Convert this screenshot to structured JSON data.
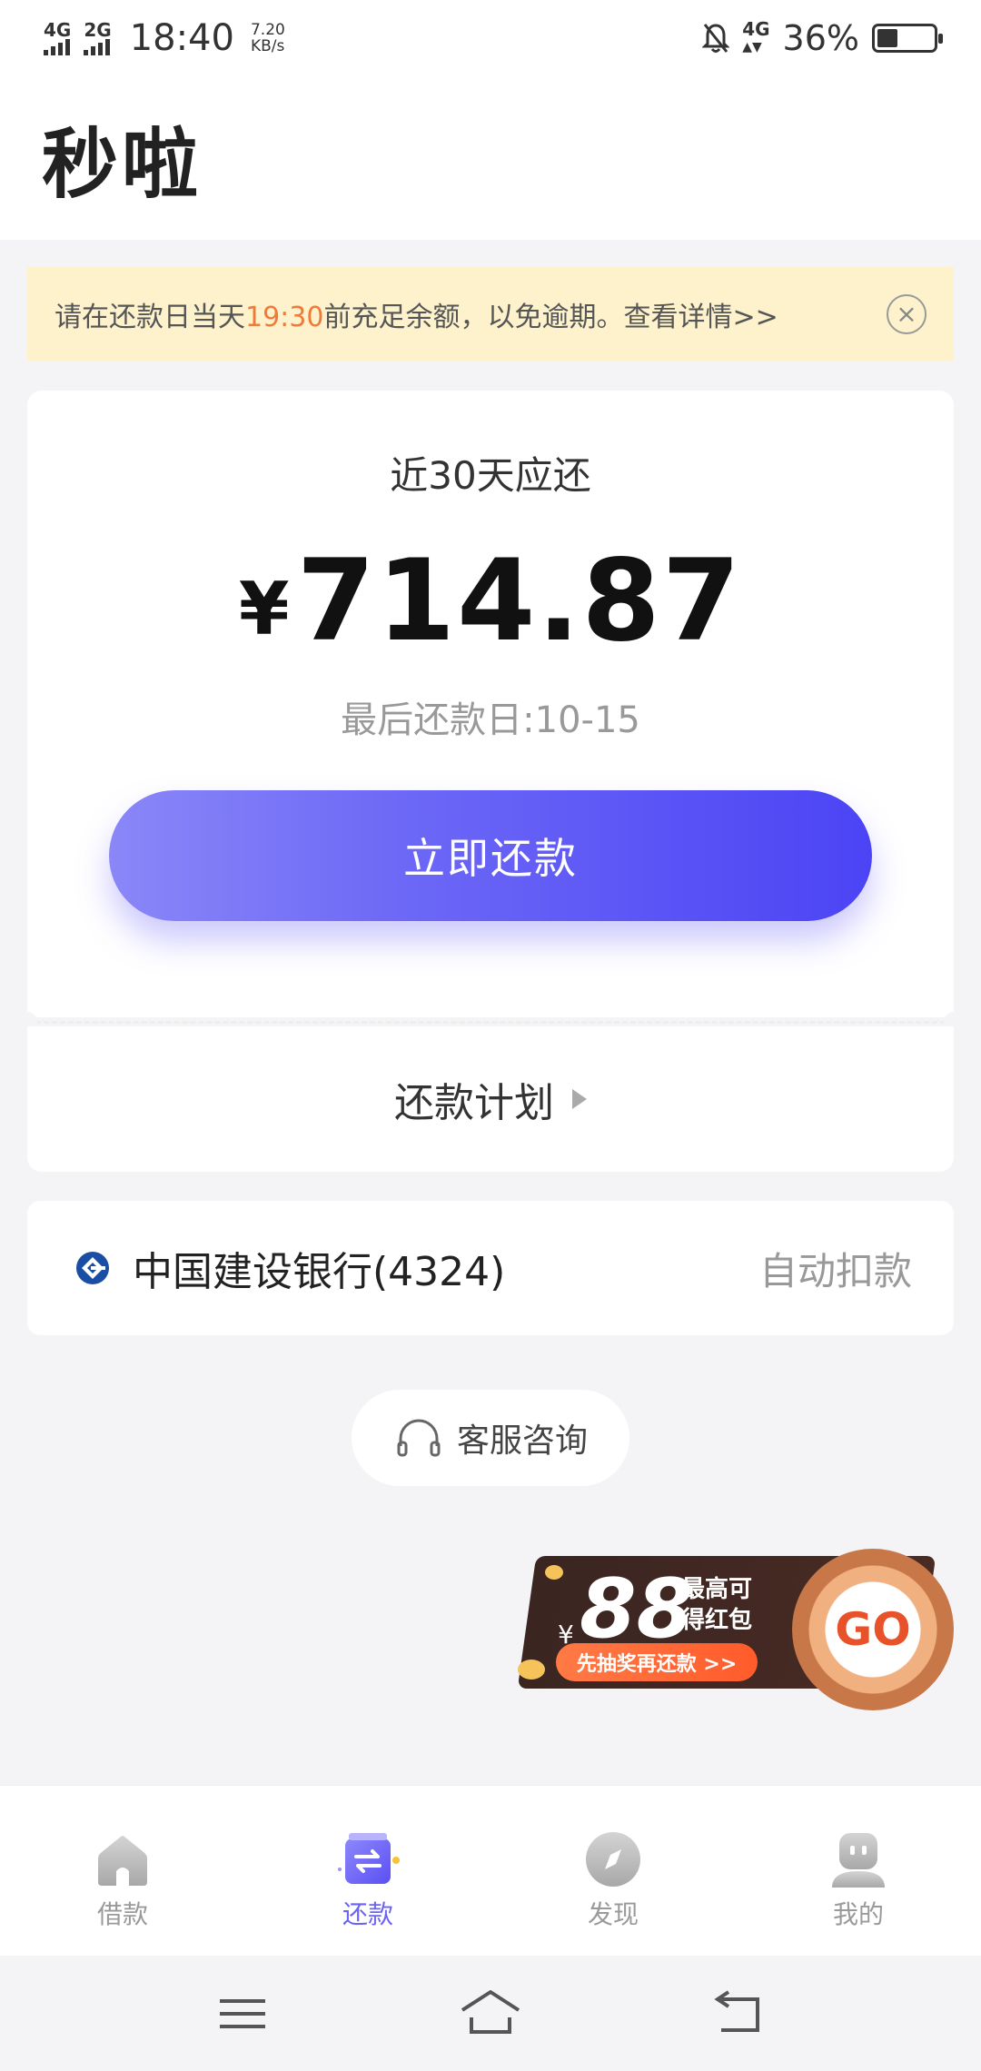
{
  "status_bar": {
    "net1": "4G",
    "net2": "2G",
    "time": "18:40",
    "speed_value": "7.20",
    "speed_unit": "KB/s",
    "net_right": "4G",
    "battery": "36%",
    "battery_level": 0.36
  },
  "header": {
    "title": "秒啦"
  },
  "notice": {
    "prefix": "请在还款日当天",
    "highlight": "19:30",
    "suffix": "前充足余额，以免逾期。查看详情>>",
    "close_symbol": "×"
  },
  "repayment": {
    "label": "近30天应还",
    "currency": "¥",
    "amount": "714.87",
    "due_date": "最后还款日:10-15",
    "pay_button": "立即还款",
    "plan_label": "还款计划"
  },
  "bank": {
    "name": "中国建设银行(4324)",
    "mode": "自动扣款"
  },
  "service": {
    "label": "客服咨询"
  },
  "promo": {
    "currency": "¥",
    "amount": "88",
    "line1": "最高可",
    "line2": "得红包",
    "sub": "先抽奖再还款 >>",
    "go": "GO"
  },
  "tabs": [
    {
      "label": "借款",
      "icon": "home-icon",
      "active": false
    },
    {
      "label": "还款",
      "icon": "repay-icon",
      "active": true
    },
    {
      "label": "发现",
      "icon": "compass-icon",
      "active": false
    },
    {
      "label": "我的",
      "icon": "profile-icon",
      "active": false
    }
  ],
  "colors": {
    "accent": "#6c63f5",
    "highlight": "#f07a3a",
    "notice_bg": "#fdf2cc"
  }
}
